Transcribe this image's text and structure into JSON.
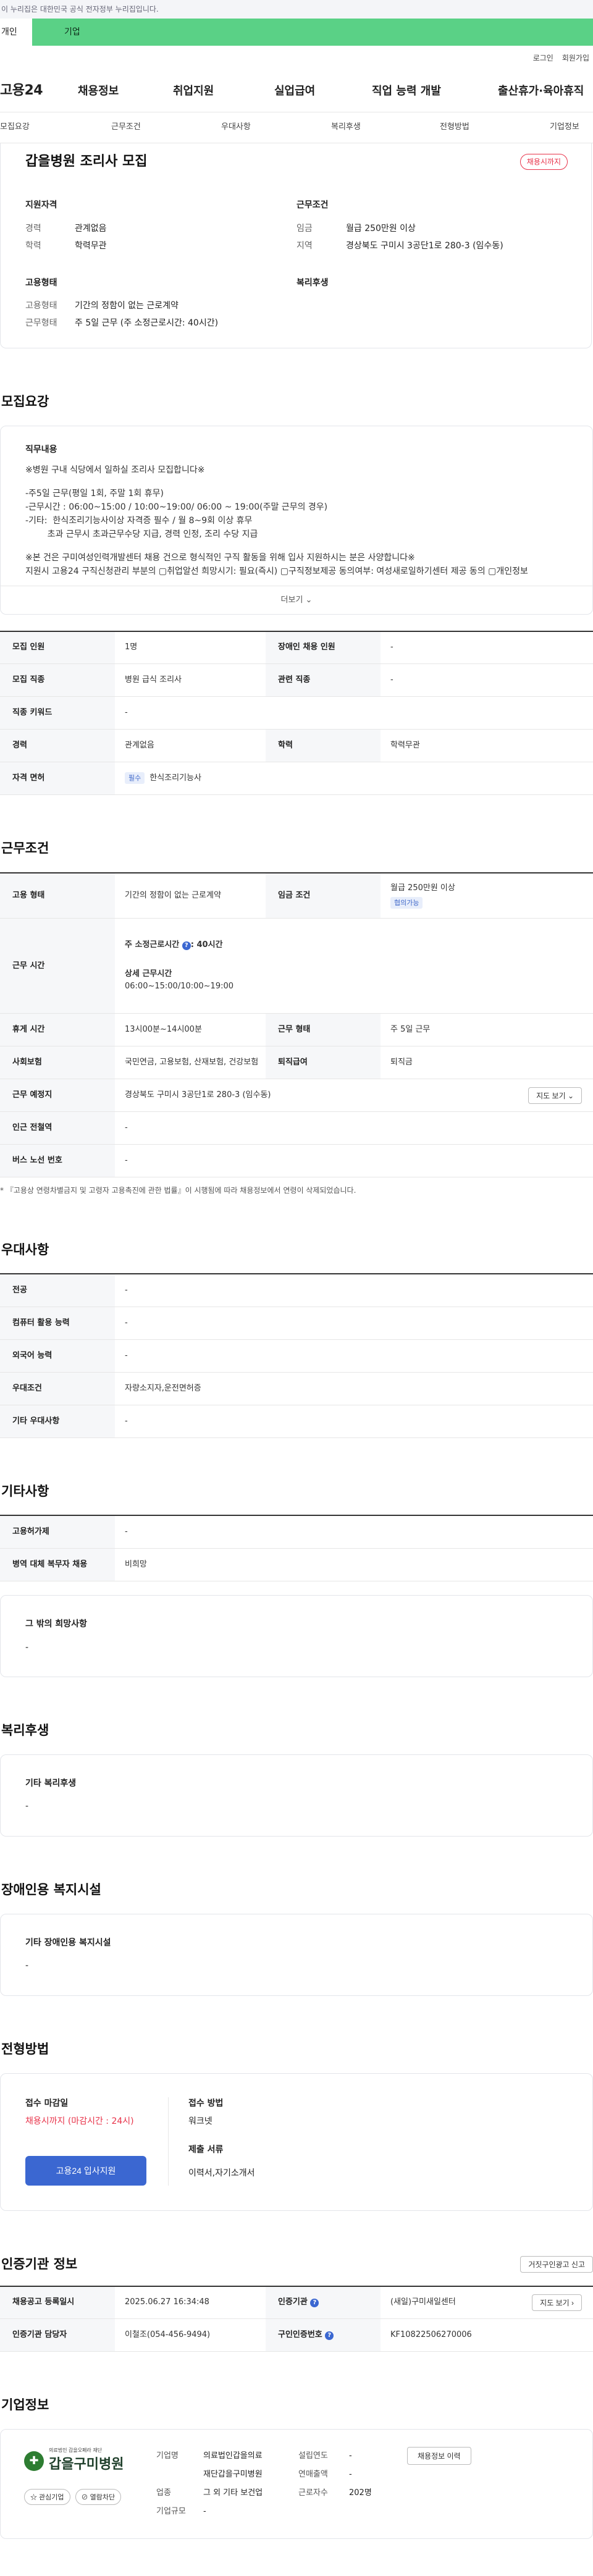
{
  "gov_banner": "이 누리집은 대한민국 공식 전자정부 누리집입니다.",
  "user_tabs": {
    "individual": "개인",
    "corporate": "기업"
  },
  "util": {
    "login": "로그인",
    "join": "회원가입"
  },
  "gnb": {
    "logo": "고용24",
    "menus": [
      "채용정보",
      "취업지원",
      "실업급여",
      "직업 능력 개발",
      "출산휴가·육아휴직"
    ]
  },
  "subnav": [
    "모집요강",
    "근무조건",
    "우대사항",
    "복리후생",
    "전형방법",
    "기업정보"
  ],
  "job": {
    "title": "갑을병원 조리사 모집",
    "badge": "채용시까지",
    "qual": {
      "heading": "지원자격",
      "career_k": "경력",
      "career_v": "관계없음",
      "edu_k": "학력",
      "edu_v": "학력무관"
    },
    "cond": {
      "heading": "근무조건",
      "wage_k": "임금",
      "wage_v": "월급 250만원 이상",
      "area_k": "지역",
      "area_v": "경상북도 구미시 3공단1로 280-3 (임수동)"
    },
    "type": {
      "heading": "고용형태",
      "emp_k": "고용형태",
      "emp_v": "기간의 정함이 없는 근로계약",
      "work_k": "근무형태",
      "work_v": "주 5일 근무 (주 소정근로시간: 40시간)"
    },
    "welfare": {
      "heading": "복리후생"
    }
  },
  "recruit": {
    "section_title": "모집요강",
    "duty_heading": "직무내용",
    "duty_lines": [
      "※병원 구내 식당에서 일하실 조리사 모집합니다※",
      "",
      "-주5일 근무(평일 1회, 주말 1회 휴무)",
      "-근무시간 : 06:00~15:00 / 10:00~19:00/ 06:00 ~ 19:00(주말 근무의 경우)",
      "-기타:  한식조리기능사이상 자격증 필수 / 월 8~9회 이상 휴무",
      "        초과 근무시 초과근무수당 지급, 경력 인정, 조리 수당 지급",
      "",
      "※본 건은 구미여성인력개발센터 채용 건으로 형식적인 구직 활동을 위해 입사 지원하시는 분은 사양합니다※",
      "지원시 고용24 구직신청관리 부분의 ▢취업알선 희망시기: 필요(즉시) ▢구직정보제공 동의여부: 여성새로일하기센터 제공 동의 ▢개인정보"
    ],
    "more": "더보기 ⌄",
    "table": {
      "count_k": "모집 인원",
      "count_v": "1명",
      "disabled_k": "장애인 채용 인원",
      "disabled_v": "-",
      "job_k": "모집 직종",
      "job_v": "병원 급식 조리사",
      "related_k": "관련 직종",
      "related_v": "-",
      "keyword_k": "직종 키워드",
      "keyword_v": "-",
      "career_k": "경력",
      "career_v": "관계없음",
      "edu_k": "학력",
      "edu_v": "학력무관",
      "license_k": "자격 면허",
      "license_chip": "필수",
      "license_v": "한식조리기능사"
    }
  },
  "work": {
    "section_title": "근무조건",
    "emp_k": "고용 형태",
    "emp_v": "기간의 정함이 없는 근로계약",
    "wage_k": "임금 조건",
    "wage_v": "월급 250만원 이상",
    "wage_chip": "협의가능",
    "time_k": "근무 시간",
    "time_h1": "주 소정근로시간",
    "time_h1_v": "40시간",
    "time_h2": "상세 근무시간",
    "time_h2_v": "06:00~15:00/10:00~19:00",
    "rest_k": "휴게 시간",
    "rest_v": "13시00분~14시00분",
    "form_k": "근무 형태",
    "form_v": "주 5일 근무",
    "ins_k": "사회보험",
    "ins_v": "국민연금, 고용보험, 산재보험, 건강보험",
    "pension_k": "퇴직급여",
    "pension_v": "퇴직금",
    "place_k": "근무 예정지",
    "place_v": "경상북도 구미시 3공단1로 280-3 (임수동)",
    "map_btn": "지도 보기 ⌄",
    "subway_k": "인근 전철역",
    "subway_v": "-",
    "bus_k": "버스 노선 번호",
    "bus_v": "-",
    "note": "* 『고용상 연령차별금지 및 고령자 고용촉진에 관한 법률』이 시행됨에 따라 채용정보에서 연령이 삭제되었습니다."
  },
  "pref": {
    "section_title": "우대사항",
    "major_k": "전공",
    "major_v": "-",
    "pc_k": "컴퓨터 활용 능력",
    "pc_v": "-",
    "lang_k": "외국어 능력",
    "lang_v": "-",
    "cond_k": "우대조건",
    "cond_v": "자량소지자,운전면허증",
    "etc_k": "기타 우대사항",
    "etc_v": "-"
  },
  "other": {
    "section_title": "기타사항",
    "permit_k": "고용허가제",
    "permit_v": "-",
    "military_k": "병역 대체 복무자 채용",
    "military_v": "비희망",
    "hope_h": "그 밖의 희망사항",
    "hope_v": "-"
  },
  "welfare": {
    "section_title": "복리후생",
    "h": "기타 복리후생",
    "v": "-"
  },
  "facility": {
    "section_title": "장애인용 복지시설",
    "h": "기타 장애인용 복지시설",
    "v": "-"
  },
  "apply": {
    "section_title": "전형방법",
    "deadline_h": "접수 마감일",
    "deadline_v": "채용시까지 (마감시간 : 24시)",
    "apply_btn": "고용24 입사지원",
    "method_h": "접수 방법",
    "method_v": "워크넷",
    "docs_h": "제출 서류",
    "docs_v": "이력서,자기소개서"
  },
  "cert": {
    "section_title": "인증기관 정보",
    "report_btn": "거짓구인광고 신고",
    "reg_k": "채용공고 등록일시",
    "reg_v": "2025.06.27 16:34:48",
    "org_k": "인증기관",
    "org_v": "(새일)구미새일센터",
    "map_btn": "지도 보기 ›",
    "staff_k": "인증기관 담당자",
    "staff_v": "이철조(054-456-9494)",
    "auth_k": "구인인증번호",
    "auth_v": "KF10822506270006"
  },
  "corp": {
    "section_title": "기업정보",
    "logo_sub": "의료법인 갑을오페라 재단",
    "logo_name": "갑을구미병원",
    "fav_btn": "☆ 관심기업",
    "block_btn": "⊘ 열람차단",
    "history_btn": "채용정보 이력",
    "name_k": "기업명",
    "name_v1": "의료법인갑을의료",
    "name_v2": "재단갑을구미병원",
    "ind_k": "업종",
    "ind_v": "그 외 기타 보건업",
    "size_k": "기업규모",
    "size_v": "-",
    "year_k": "설립연도",
    "year_v": "-",
    "sales_k": "연매출액",
    "sales_v": "-",
    "emp_k": "근로자수",
    "emp_v": "202명"
  }
}
